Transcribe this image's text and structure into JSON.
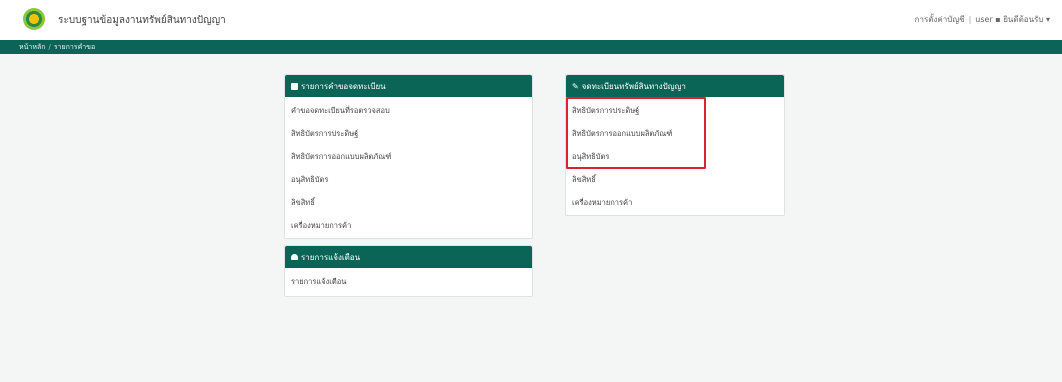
{
  "header": {
    "title": "ระบบฐานข้อมูลงานทรัพย์สินทางปัญญา",
    "user_link_1": "การตั้งค่าบัญชี",
    "user_link_2": "user ▪ ยินดีต้อนรับ ▾"
  },
  "breadcrumb": {
    "home": "หน้าหลัก",
    "current": "รายการคำขอ"
  },
  "panels": {
    "requests": {
      "title": "รายการคำขอจดทะเบียน",
      "items": [
        "คำขอจดทะเบียนที่รอตรวจสอบ",
        "สิทธิบัตรการประดิษฐ์",
        "สิทธิบัตรการออกแบบผลิตภัณฑ์",
        "อนุสิทธิบัตร",
        "ลิขสิทธิ์",
        "เครื่องหมายการค้า"
      ]
    },
    "notifications": {
      "title": "รายการแจ้งเตือน",
      "items": [
        "รายการแจ้งเตือน"
      ]
    },
    "register": {
      "title": "จดทะเบียนทรัพย์สินทางปัญญา",
      "items": [
        "สิทธิบัตรการประดิษฐ์",
        "สิทธิบัตรการออกแบบผลิตภัณฑ์",
        "อนุสิทธิบัตร",
        "ลิขสิทธิ์",
        "เครื่องหมายการค้า"
      ]
    }
  },
  "colors": {
    "primary": "#0b6556",
    "highlight": "#d9232e"
  }
}
